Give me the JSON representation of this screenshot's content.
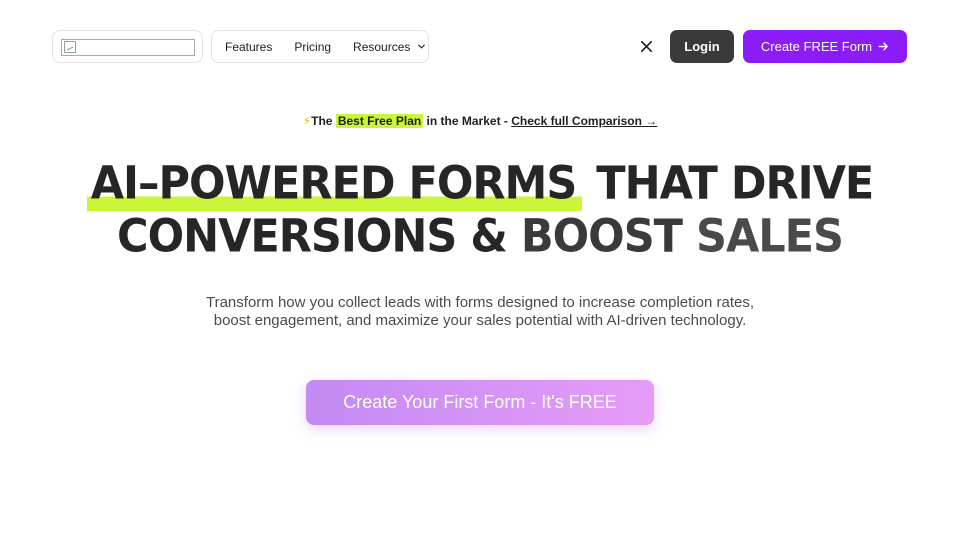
{
  "header": {
    "nav": [
      {
        "label": "Features"
      },
      {
        "label": "Pricing"
      },
      {
        "label": "Resources"
      }
    ],
    "login_label": "Login",
    "cta_label": "Create FREE Form"
  },
  "promo": {
    "prefix": "The",
    "highlight": "Best Free Plan",
    "middle": "in the Market -",
    "link": "Check full Comparison →"
  },
  "hero": {
    "line1_highlight": "AI–POWERED FORMS",
    "line1_rest": "THAT DRIVE",
    "line2_start": "CONVERSIONS &",
    "line2_boost": "BOOST",
    "line2_sales": "SALES",
    "subtext_line1": "Transform how you collect leads with forms designed to increase completion rates,",
    "subtext_line2": "boost engagement, and maximize your sales potential with AI-driven technology.",
    "cta_label": "Create Your First Form - It's FREE"
  },
  "colors": {
    "accent_purple": "#8b1cf7",
    "highlight_green": "#c9f53a",
    "login_dark": "#3a3a3a"
  },
  "icons": {
    "social": "x-logo-icon",
    "dropdown": "chevron-down-icon",
    "cta_arrow": "arrow-right-icon",
    "promo": "lightning-icon"
  }
}
